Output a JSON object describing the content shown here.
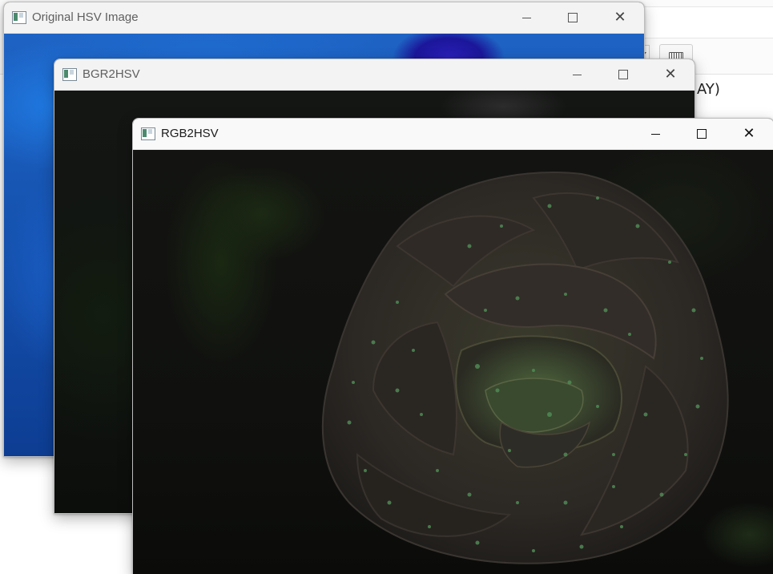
{
  "background_app": {
    "code_fragment": "AY)"
  },
  "windows": [
    {
      "id": "original",
      "title": "Original HSV Image",
      "active": false
    },
    {
      "id": "bgr2hsv",
      "title": "BGR2HSV",
      "active": false
    },
    {
      "id": "rgb2hsv",
      "title": "RGB2HSV",
      "active": true
    }
  ],
  "window_controls": {
    "minimize": "minimize-icon",
    "maximize": "maximize-icon",
    "close": "close-icon",
    "close_glyph": "✕"
  },
  "colors": {
    "original_image_tint": "#1653b0",
    "rose_petal": "#2e2a26",
    "droplet_green": "#4f8a55"
  }
}
